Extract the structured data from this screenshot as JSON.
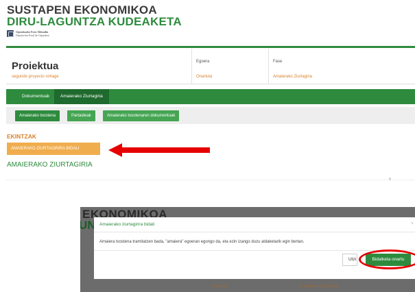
{
  "header": {
    "title_line1": "SUSTAPEN EKONOMIKOA",
    "title_line2": "DIRU-LAGUNTZA KUDEAKETA",
    "logo_line1": "Gipuzkoako Foru Aldundia",
    "logo_line2": "Diputación Foral de Gipuzkoa"
  },
  "project": {
    "label": "Proiektua",
    "name": "segundo proyecto vintage",
    "egoera_label": "Egoera",
    "egoera_value": "Onartuta",
    "fase_label": "Fase",
    "fase_value": "Amaierako Ziurtagiria"
  },
  "tabs": [
    {
      "label": "Dokumentuak"
    },
    {
      "label": "Amaierako Ziurtagiria"
    }
  ],
  "subtabs": [
    {
      "label": "Amaierako txostena"
    },
    {
      "label": "Partaideak"
    },
    {
      "label": "Amaierako txostenaren dokumentuak"
    }
  ],
  "actions": {
    "section_label": "EKINTZAK",
    "send_button": "AMAIERAKO ZIURTAGIRIRA BIDALI"
  },
  "section_title": "AMAIERAKO ZIURTAGIRIA",
  "modal": {
    "title": "Amaierako ziurtagirira bidali",
    "close": "×",
    "body": "Amaiera txostena tramitatzen bada, \"amaiera\" egoeran egongo da, eta ezin izango duzu aldaketarik egin bertan.",
    "cancel_label": "Utzi",
    "accept_label": "Bidalketa onartu"
  },
  "background": {
    "title_line1": "EKONOMIKOA",
    "title_line2": "UNT",
    "egoera_value": "Onartuta",
    "fase_value": "Amaierako Ziurtagiria"
  },
  "colors": {
    "brand_green": "#2e8b3e",
    "accent_orange": "#f0ad4e",
    "highlight_red": "#e60000"
  },
  "icons": {
    "logo": "gipuzkoa-shield-icon",
    "arrow": "red-arrow-left-icon"
  }
}
